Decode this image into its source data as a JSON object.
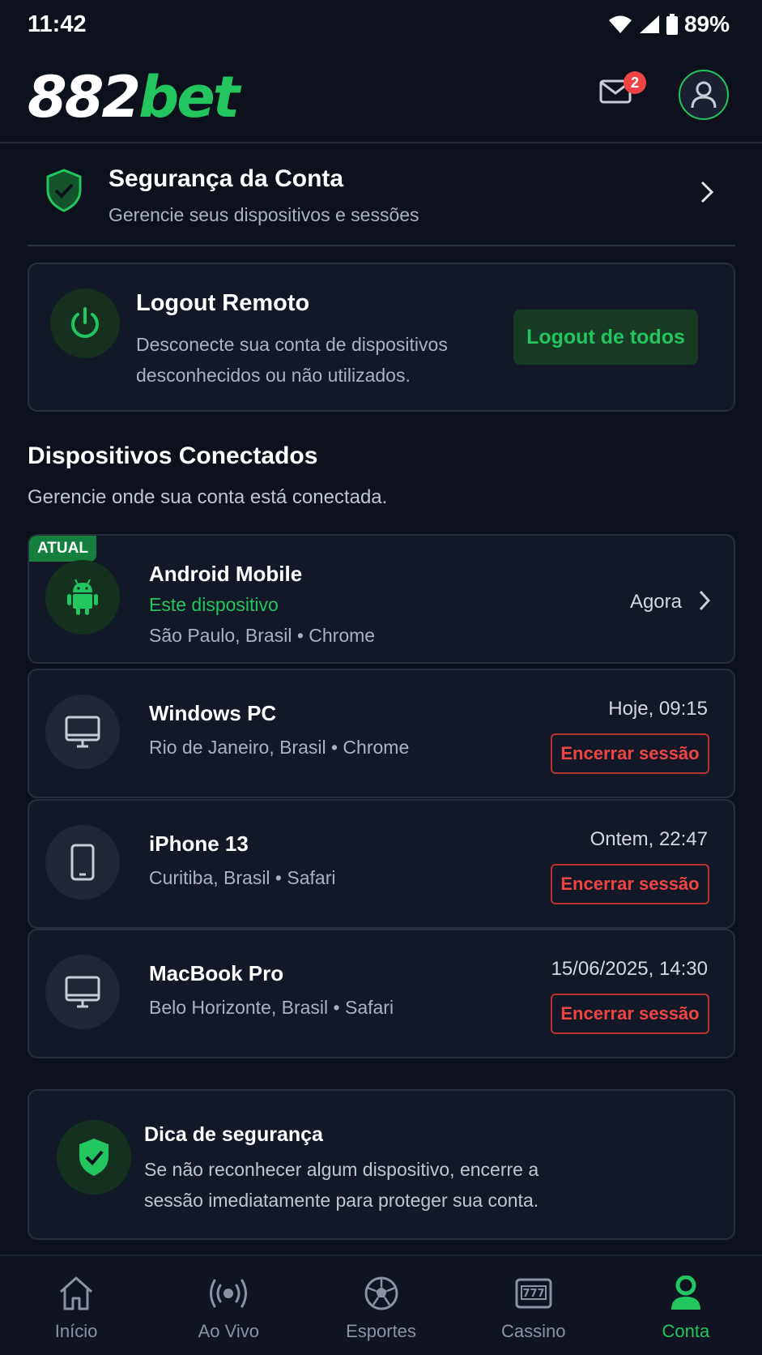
{
  "status_bar": {
    "time": "11:42",
    "battery": "89%"
  },
  "header": {
    "logo_number": "882",
    "logo_brand": "bet",
    "mail_badge": "2"
  },
  "security": {
    "title": "Segurança da Conta",
    "subtitle": "Gerencie seus dispositivos e sessões"
  },
  "logout": {
    "title": "Logout Remoto",
    "description": "Desconecte sua conta de dispositivos desconhecidos ou não utilizados.",
    "button_label": "Logout de todos"
  },
  "devices_section": {
    "title": "Dispositivos Conectados",
    "subtitle": "Gerencie onde sua conta está conectada."
  },
  "devices": [
    {
      "badge": "ATUAL",
      "name": "Android Mobile",
      "status": "Este dispositivo",
      "location": "São Paulo, Brasil • Chrome",
      "time": "Agora"
    },
    {
      "name": "Windows PC",
      "location": "Rio de Janeiro, Brasil • Chrome",
      "time": "Hoje, 09:15",
      "action": "Encerrar sessão"
    },
    {
      "name": "iPhone 13",
      "location": "Curitiba, Brasil • Safari",
      "time": "Ontem, 22:47",
      "action": "Encerrar sessão"
    },
    {
      "name": "MacBook Pro",
      "location": "Belo Horizonte, Brasil • Safari",
      "time": "15/06/2025, 14:30",
      "action": "Encerrar sessão"
    }
  ],
  "tip": {
    "title": "Dica de segurança",
    "text": "Se não reconhecer algum dispositivo, encerre a sessão imediatamente para proteger sua conta."
  },
  "nav": {
    "items": [
      {
        "label": "Início",
        "icon": "home-icon"
      },
      {
        "label": "Ao Vivo",
        "icon": "live-icon"
      },
      {
        "label": "Esportes",
        "icon": "soccer-ball-icon"
      },
      {
        "label": "Cassino",
        "icon": "slot-machine-icon"
      },
      {
        "label": "Conta",
        "icon": "user-icon",
        "active": true
      }
    ]
  },
  "colors": {
    "accent": "#22c55e",
    "danger": "#ef4444",
    "background": "#0c111b"
  }
}
